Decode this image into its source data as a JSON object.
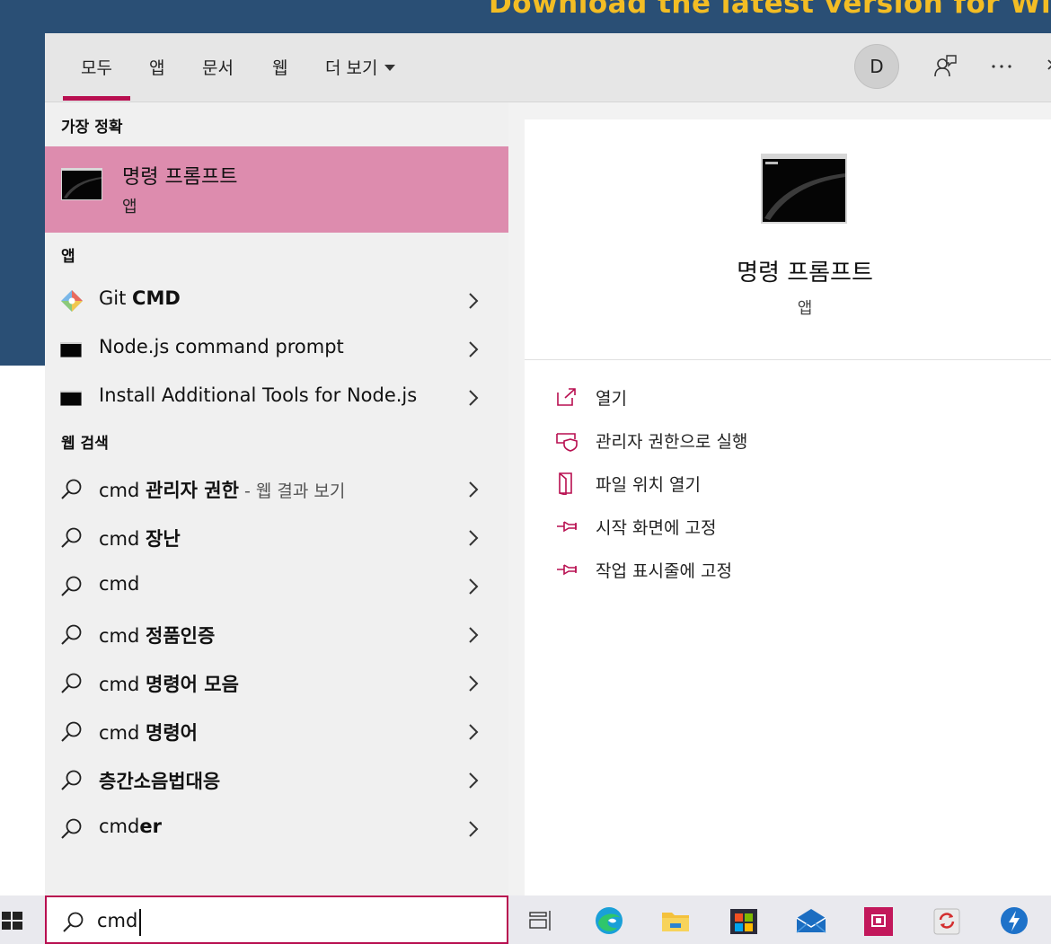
{
  "background": {
    "banner": "Download the latest version for Wi"
  },
  "tabs": [
    {
      "label": "모두",
      "active": true
    },
    {
      "label": "앱"
    },
    {
      "label": "문서"
    },
    {
      "label": "웹"
    },
    {
      "label": "더 보기"
    }
  ],
  "header": {
    "avatar_letter": "D",
    "feedback_icon": "feedback-icon",
    "more_icon": "more-icon",
    "close_icon": "close-icon"
  },
  "best_match": {
    "section": "가장 정확",
    "title": "명령 프롬프트",
    "subtitle": "앱",
    "icon": "cmd-icon"
  },
  "apps": {
    "section": "앱",
    "items": [
      {
        "prefix": "Git ",
        "bold": "CMD",
        "icon": "git-icon"
      },
      {
        "prefix": "Node.js command prompt",
        "bold": "",
        "icon": "terminal-icon"
      },
      {
        "prefix": "Install Additional Tools for Node.js",
        "bold": "",
        "icon": "terminal-icon"
      }
    ]
  },
  "web": {
    "section": "웹 검색",
    "items": [
      {
        "prefix": "cmd ",
        "bold": "관리자 권한",
        "hint": " - 웹 결과 보기"
      },
      {
        "prefix": "cmd ",
        "bold": "장난",
        "hint": ""
      },
      {
        "prefix": "cmd",
        "bold": "",
        "hint": ""
      },
      {
        "prefix": "cmd ",
        "bold": "정품인증",
        "hint": ""
      },
      {
        "prefix": "cmd ",
        "bold": "명령어 모음",
        "hint": ""
      },
      {
        "prefix": "cmd ",
        "bold": "명령어",
        "hint": ""
      },
      {
        "prefix": "",
        "bold": "층간소음법대응",
        "hint": ""
      },
      {
        "prefix": "cmd",
        "bold": "er",
        "hint": ""
      }
    ]
  },
  "detail": {
    "title": "명령 프롬프트",
    "subtitle": "앱",
    "actions": [
      {
        "label": "열기",
        "icon": "open-icon"
      },
      {
        "label": "관리자 권한으로 실행",
        "icon": "shield-icon"
      },
      {
        "label": "파일 위치 열기",
        "icon": "file-location-icon"
      },
      {
        "label": "시작 화면에 고정",
        "icon": "pin-icon"
      },
      {
        "label": "작업 표시줄에 고정",
        "icon": "pin-icon"
      }
    ]
  },
  "search": {
    "value": "cmd"
  },
  "taskbar": {
    "icons": [
      "task-view-icon",
      "edge-icon",
      "file-explorer-icon",
      "store-icon",
      "mail-icon",
      "app-red-icon",
      "sync-icon",
      "app-blue-icon"
    ]
  },
  "colors": {
    "accent": "#b80f50",
    "selected": "#dd8cae",
    "panel": "#f0f0f0",
    "desktop": "#2a4f75",
    "banner": "#f3bd24"
  }
}
